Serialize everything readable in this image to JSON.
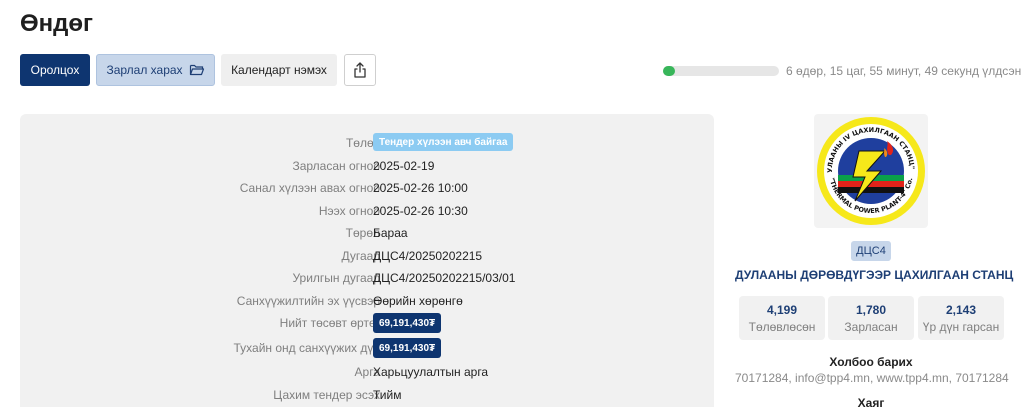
{
  "page": {
    "title": "Өндөг"
  },
  "toolbar": {
    "join_label": "Оролцох",
    "view_label": "Зарлал харах",
    "calendar_label": "Календарт нэмэх"
  },
  "timer": {
    "text": "6 өдөр, 15 цаг, 55 минут, 49 секунд үлдсэн",
    "progress_percent": 10
  },
  "details": [
    {
      "label": "Төлөв",
      "value": "Тендер хүлээн авч байгаа",
      "kind": "status"
    },
    {
      "label": "Зарласан огноо",
      "value": "2025-02-19",
      "kind": "text"
    },
    {
      "label": "Санал хүлээн авах огноо",
      "value": "2025-02-26 10:00",
      "kind": "text"
    },
    {
      "label": "Нээх огноо",
      "value": "2025-02-26 10:30",
      "kind": "text"
    },
    {
      "label": "Төрөл",
      "value": "Бараа",
      "kind": "text"
    },
    {
      "label": "Дугаар",
      "value": "ДЦС4/20250202215",
      "kind": "text"
    },
    {
      "label": "Урилгын дугаар",
      "value": "ДЦС4/20250202215/03/01",
      "kind": "text"
    },
    {
      "label": "Санхүүжилтийн эх үүсвэр",
      "value": "Өөрийн хөрөнгө",
      "kind": "text"
    },
    {
      "label": "Нийт төсөвт өртөг",
      "value": "69,191,430₮",
      "kind": "money"
    },
    {
      "label": "Тухайн онд санхүүжих дүн",
      "value": "69,191,430₮",
      "kind": "money"
    },
    {
      "label": "Арга",
      "value": "Харьцуулалтын арга",
      "kind": "text"
    },
    {
      "label": "Цахим тендер эсэх",
      "value": "Тийм",
      "kind": "text"
    }
  ],
  "organization": {
    "logo_ring_text_top": "\"ДУЛААНЫ IV ЦАХИЛГААН СТАНЦ\" ХК",
    "logo_ring_text_bottom": "\"THERMAL POWER PLANT-4\" Co.",
    "code": "ДЦС4",
    "name": "ДУЛААНЫ ДӨРӨВДҮГЭЭР ЦАХИЛГААН СТАНЦ",
    "stats": [
      {
        "value": "4,199",
        "label": "Төлөвлөсөн"
      },
      {
        "value": "1,780",
        "label": "Зарласан"
      },
      {
        "value": "2,143",
        "label": "Үр дүн гарсан"
      }
    ],
    "contact_title": "Холбоо барих",
    "contact_text": "70171284, info@tpp4.mn, www.tpp4.mn, 70171284",
    "address_title": "Хаяг"
  },
  "colors": {
    "primary": "#0e3570",
    "accent_light": "#c7d6ea",
    "status_badge": "#8ccbf2",
    "progress": "#38b65a"
  },
  "icons": {
    "view": "folder-open-icon",
    "share": "share-icon"
  }
}
